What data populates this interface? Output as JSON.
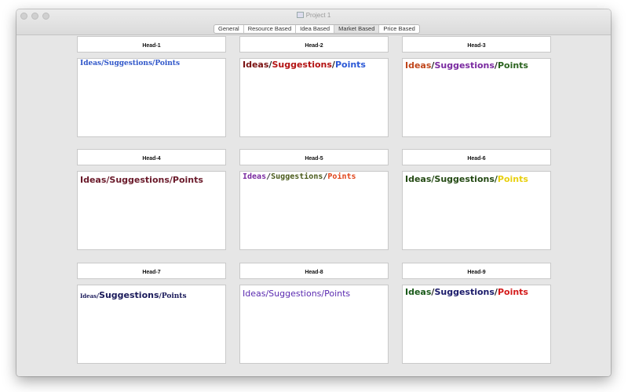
{
  "window": {
    "title": "Project 1"
  },
  "tabs": [
    {
      "label": "General",
      "active": false
    },
    {
      "label": "Resource Based",
      "active": false
    },
    {
      "label": "Idea Based",
      "active": false
    },
    {
      "label": "Market Based",
      "active": true
    },
    {
      "label": "Price Based",
      "active": false
    }
  ],
  "panels": [
    {
      "head": "Head-1",
      "parts": [
        {
          "text": "Ideas/Suggestions/Points",
          "color": "#2f56c9"
        }
      ]
    },
    {
      "head": "Head-2",
      "parts": [
        {
          "text": "Ideas",
          "color": "#7a1212"
        },
        {
          "text": "/",
          "color": "#222222"
        },
        {
          "text": "Suggestions",
          "color": "#b31212"
        },
        {
          "text": "/",
          "color": "#222222"
        },
        {
          "text": "Points",
          "color": "#2b58d6"
        }
      ]
    },
    {
      "head": "Head-3",
      "parts": [
        {
          "text": "Ideas",
          "color": "#c0461b"
        },
        {
          "text": "/",
          "color": "#222222"
        },
        {
          "text": "Suggestions",
          "color": "#7a2aa0"
        },
        {
          "text": "/",
          "color": "#222222"
        },
        {
          "text": "Points",
          "color": "#2c6420"
        }
      ]
    },
    {
      "head": "Head-4",
      "parts": [
        {
          "text": "Ideas/Suggestions/Points",
          "color": "#6a1a2a"
        }
      ]
    },
    {
      "head": "Head-5",
      "parts": [
        {
          "text": "Ideas",
          "color": "#7a2aa0"
        },
        {
          "text": "/",
          "color": "#333333"
        },
        {
          "text": "Suggestions",
          "color": "#4a5a1a"
        },
        {
          "text": "/",
          "color": "#333333"
        },
        {
          "text": "Points",
          "color": "#e0441a"
        }
      ]
    },
    {
      "head": "Head-6",
      "parts": [
        {
          "text": "Ideas/Suggestions/",
          "color": "#244a14"
        },
        {
          "text": "Points",
          "color": "#e8d010"
        }
      ]
    },
    {
      "head": "Head-7",
      "parts": [
        {
          "text": "Ideas",
          "color": "#1a1a5a"
        },
        {
          "text": "/",
          "color": "#1a1a5a"
        },
        {
          "text": "Suggestions",
          "color": "#1a1a5a"
        },
        {
          "text": "/",
          "color": "#1a1a5a"
        },
        {
          "text": "Points",
          "color": "#1a1a5a"
        }
      ]
    },
    {
      "head": "Head-8",
      "parts": [
        {
          "text": "Ideas/Suggestions/Points",
          "color": "#5a2ab0"
        }
      ]
    },
    {
      "head": "Head-9",
      "parts": [
        {
          "text": "Ideas",
          "color": "#1a5a1a"
        },
        {
          "text": "/",
          "color": "#222222"
        },
        {
          "text": "Suggestions",
          "color": "#1a1a6a"
        },
        {
          "text": "/",
          "color": "#222222"
        },
        {
          "text": "Points",
          "color": "#d41a1a"
        }
      ]
    }
  ]
}
